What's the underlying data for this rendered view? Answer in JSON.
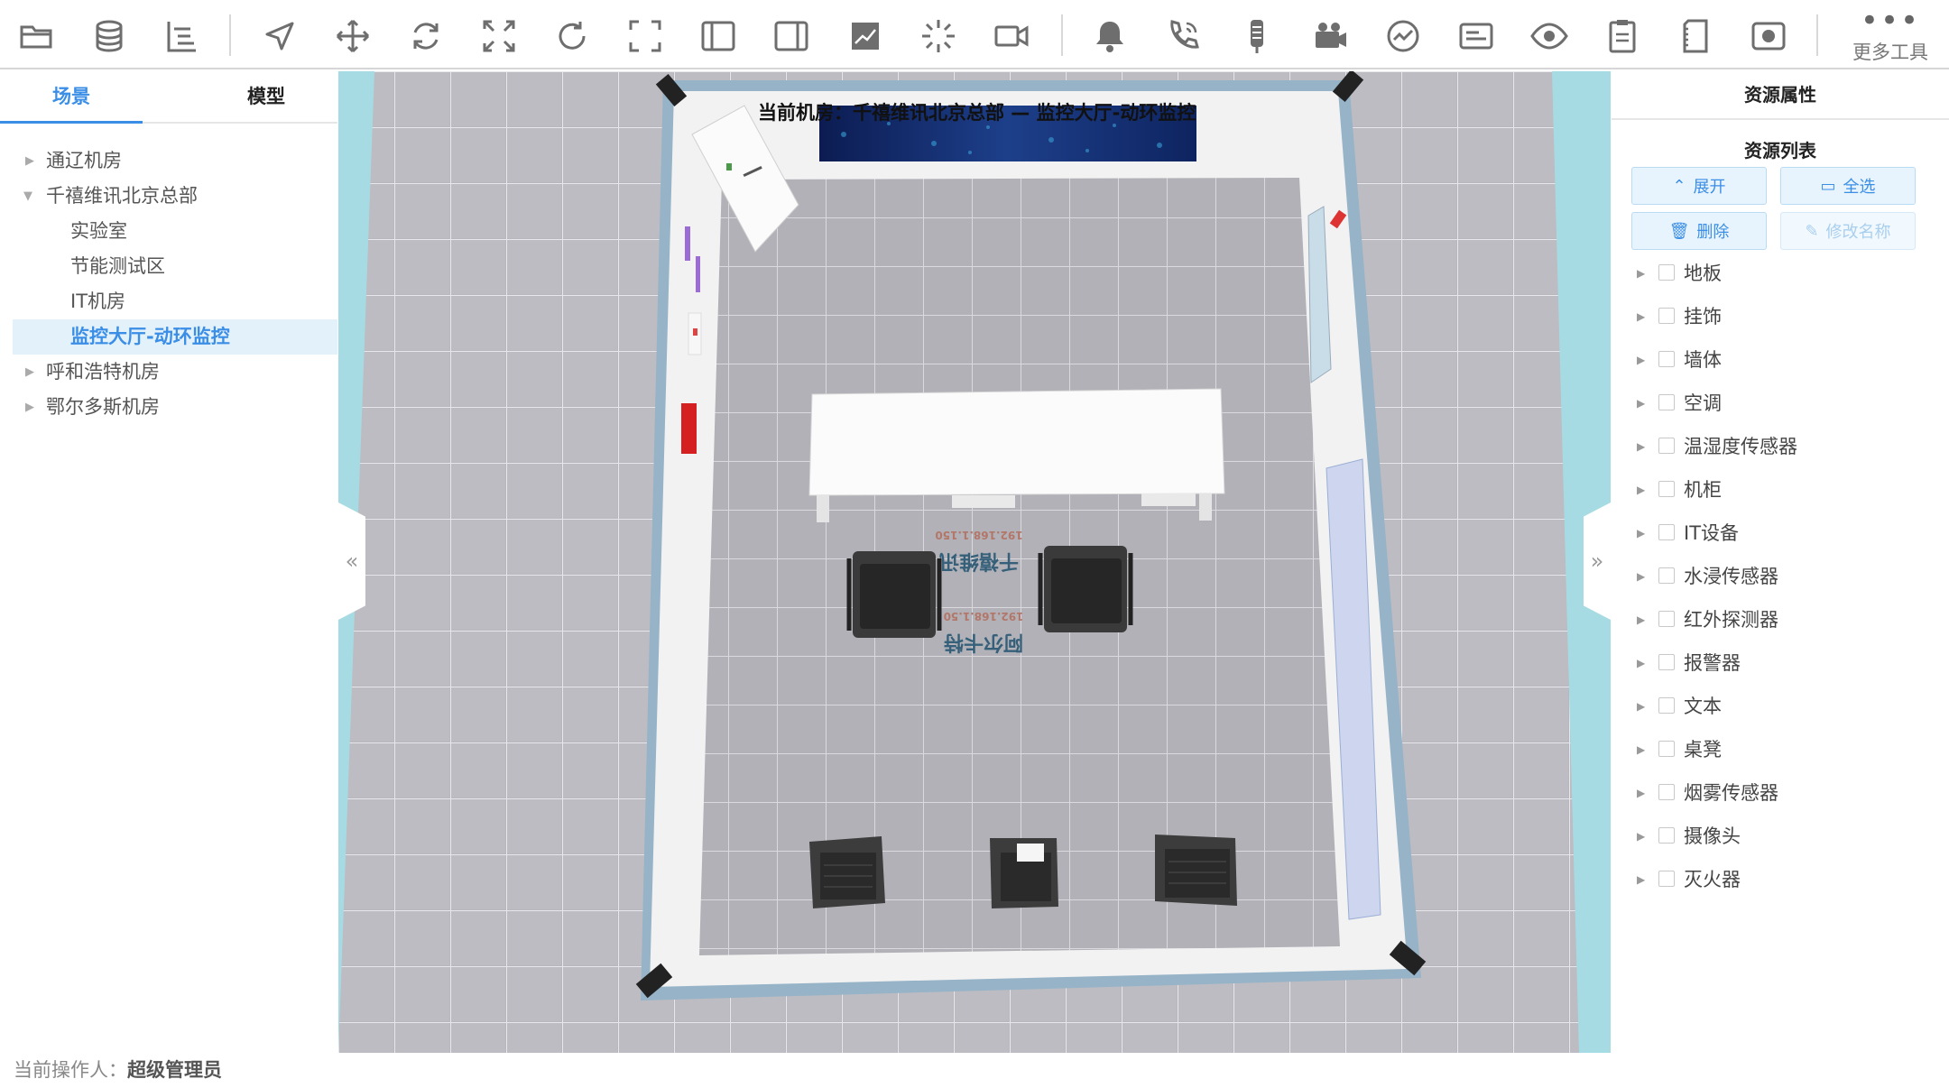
{
  "toolbar": {
    "buttons": [
      "folder-open-icon",
      "database-icon",
      "tree-structure-icon",
      "navigate-arrow-icon",
      "move-icon",
      "rotate-icon",
      "expand-icon",
      "refresh-icon",
      "fullscreen-icon",
      "left-panel-icon",
      "right-panel-icon",
      "chart-icon",
      "loading-spinner-icon",
      "video-camera-icon",
      "bell-icon",
      "phone-icon",
      "sensor-icon",
      "camera-device-icon",
      "gauge-icon",
      "card-icon",
      "eye-icon",
      "clipboard-icon",
      "document-icon",
      "record-icon"
    ],
    "more_label": "更多工具",
    "icon_color": "#6e6e6e"
  },
  "left_panel": {
    "tabs": [
      "场景",
      "模型"
    ],
    "active_tab": "场景",
    "tree": [
      {
        "label": "通辽机房",
        "level": 0,
        "expanded": false,
        "selected": false
      },
      {
        "label": "千禧维讯北京总部",
        "level": 0,
        "expanded": true,
        "selected": false
      },
      {
        "label": "实验室",
        "level": 1,
        "expanded": false,
        "selected": false
      },
      {
        "label": "节能测试区",
        "level": 1,
        "expanded": false,
        "selected": false
      },
      {
        "label": "IT机房",
        "level": 1,
        "expanded": false,
        "selected": false
      },
      {
        "label": "监控大厅-动环监控",
        "level": 1,
        "expanded": false,
        "selected": true
      },
      {
        "label": "呼和浩特机房",
        "level": 0,
        "expanded": false,
        "selected": false
      },
      {
        "label": "鄂尔多斯机房",
        "level": 0,
        "expanded": false,
        "selected": false
      }
    ],
    "accent": "#3a8ee6"
  },
  "viewport": {
    "caption": "当前机房：千禧维讯北京总部 — 监控大厅-动环监控",
    "collapse_left": "«",
    "collapse_right": "»",
    "floor_labels": [
      "千禧维讯",
      "192.168.1.150",
      "阿尔卡特",
      "192.168.1.50"
    ]
  },
  "right_panel": {
    "title": "资源属性",
    "subtitle": "资源列表",
    "buttons": {
      "expand": "展开",
      "select_all": "全选",
      "delete": "删除",
      "rename": "修改名称"
    },
    "resources": [
      "地板",
      "挂饰",
      "墙体",
      "空调",
      "温湿度传感器",
      "机柜",
      "IT设备",
      "水浸传感器",
      "红外探测器",
      "报警器",
      "文本",
      "桌凳",
      "烟雾传感器",
      "摄像头",
      "灭火器"
    ]
  },
  "status": {
    "operator_label": "当前操作人：",
    "operator_name": "超级管理员"
  }
}
